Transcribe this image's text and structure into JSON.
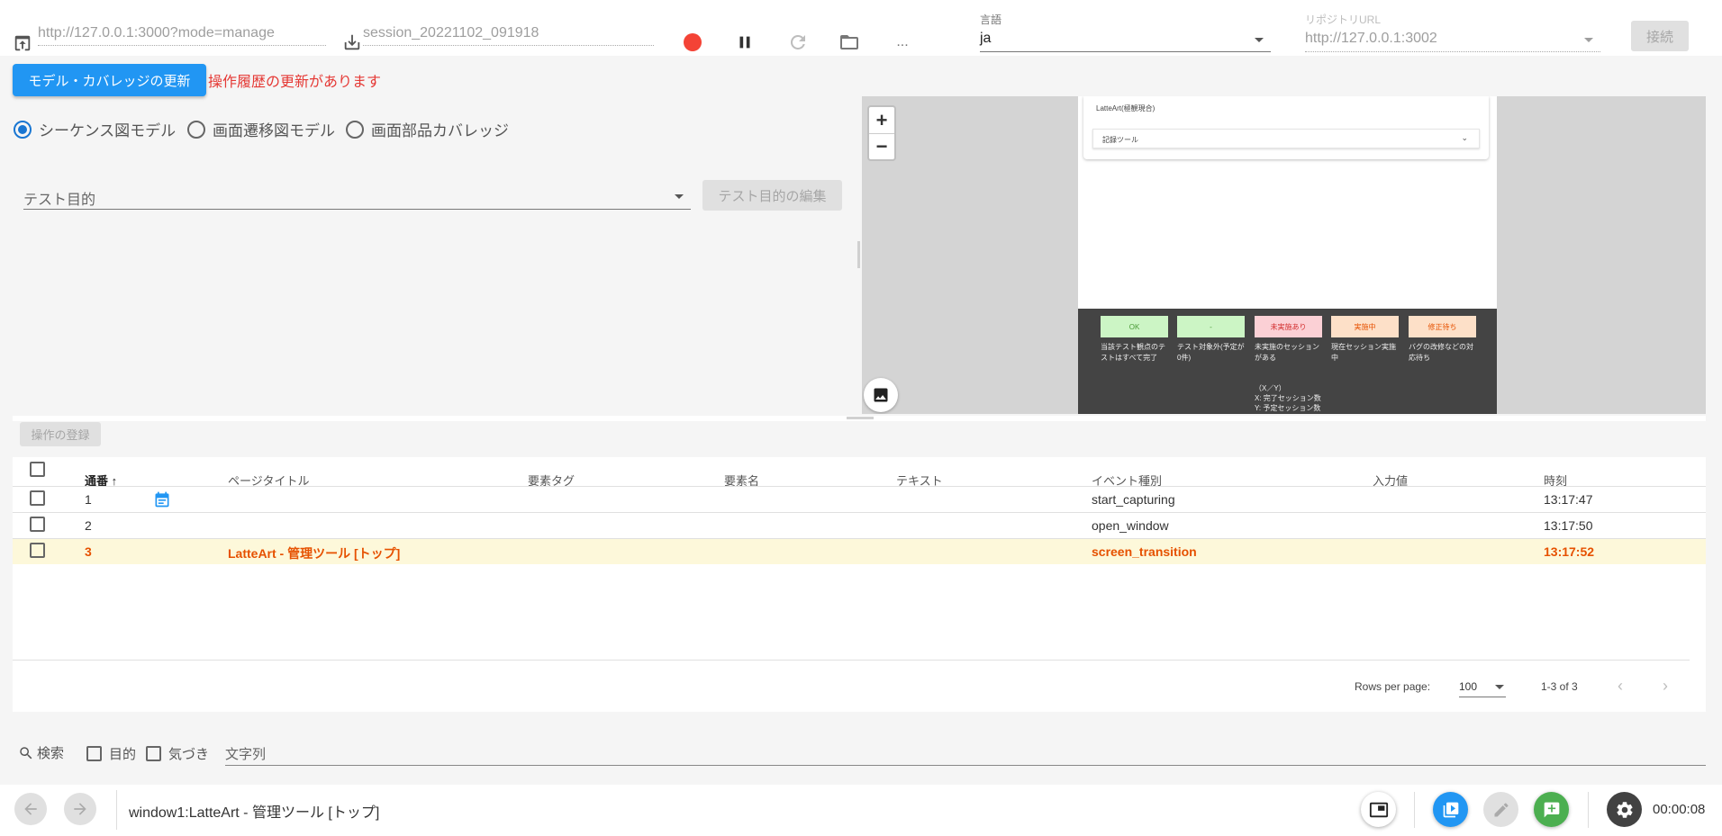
{
  "toolbar": {
    "capture_url": "http://127.0.0.1:3000?mode=manage",
    "session_name": "session_20221102_091918",
    "more_label": "...",
    "locale_label": "言語",
    "locale_value": "ja",
    "repo_label": "リポジトリURL",
    "repo_value": "http://127.0.0.1:3002",
    "connect_label": "接続"
  },
  "left": {
    "update_button": "モデル・カバレッジの更新",
    "update_message": "操作履歴の更新があります",
    "radios": [
      "シーケンス図モデル",
      "画面遷移図モデル",
      "画面部品カバレッジ"
    ],
    "purpose_placeholder": "テスト目的",
    "purpose_edit_button": "テスト目的の編集"
  },
  "preview": {
    "app_title": "LatteArt(極観現合)",
    "dropdown_value": "記録ツール",
    "statuses": [
      {
        "label": "OK",
        "desc": "当該テスト観点のテストはすべて完了",
        "bg": "#ccf5c5",
        "fg": "#4a9a36"
      },
      {
        "label": "-",
        "desc": "テスト対象外(予定が0件)",
        "bg": "#ccf5c5",
        "fg": "#4a9a36"
      },
      {
        "label": "未実施あり",
        "desc": "未実施のセッションがある",
        "bg": "#fbd0d5",
        "fg": "#d32f2f"
      },
      {
        "label": "実施中",
        "desc": "現在セッション実施中",
        "bg": "#fde0c8",
        "fg": "#e65100"
      },
      {
        "label": "修正待ち",
        "desc": "バグの改修などの対応待ち",
        "bg": "#fde0c8",
        "fg": "#e65100"
      }
    ],
    "note_lines": [
      "（X／Y）",
      "X: 完了セッション数",
      "Y: 予定セッション数"
    ]
  },
  "register_button": "操作の登録",
  "table": {
    "headers": [
      "通番",
      "ページタイトル",
      "要素タグ",
      "要素名",
      "テキスト",
      "イベント種別",
      "入力値",
      "時刻"
    ],
    "rows": [
      {
        "no": "1",
        "title": "",
        "tag": "",
        "name": "",
        "text": "",
        "event": "start_capturing",
        "input": "",
        "time": "13:17:47"
      },
      {
        "no": "2",
        "title": "",
        "tag": "",
        "name": "",
        "text": "",
        "event": "open_window",
        "input": "",
        "time": "13:17:50"
      },
      {
        "no": "3",
        "title": "LatteArt - 管理ツール [トップ]",
        "tag": "",
        "name": "",
        "text": "",
        "event": "screen_transition",
        "input": "",
        "time": "13:17:52"
      }
    ],
    "rows_per_page_label": "Rows per page:",
    "rows_per_page_value": "100",
    "range_label": "1-3 of 3"
  },
  "search": {
    "label": "検索",
    "purpose_label": "目的",
    "notice_label": "気づき",
    "placeholder": "文字列"
  },
  "bottom": {
    "window_title": "window1:LatteArt - 管理ツール [トップ]",
    "elapsed": "00:00:08"
  },
  "colors": {
    "primary": "#2196f3",
    "record": "#f44336",
    "highlight_row": "#fdf8da",
    "highlight_text": "#e65100",
    "message_red": "#e53935",
    "green_action": "#4caf50"
  }
}
